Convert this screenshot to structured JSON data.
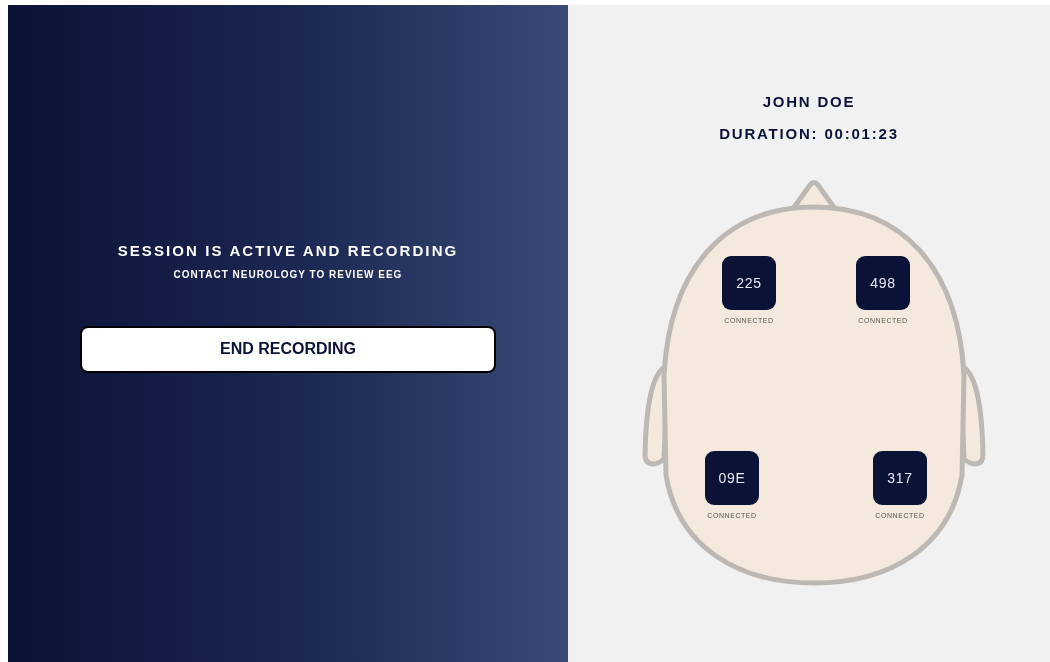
{
  "session": {
    "title": "SESSION IS ACTIVE AND RECORDING",
    "subtitle": "CONTACT NEUROLOGY TO REVIEW EEG",
    "button": "END RECORDING"
  },
  "patient": {
    "name": "JOHN DOE",
    "duration": "DURATION: 00:01:23"
  },
  "sensors": [
    {
      "id": "225",
      "status": "CONNECTED"
    },
    {
      "id": "498",
      "status": "CONNECTED"
    },
    {
      "id": "09E",
      "status": "CONNECTED"
    },
    {
      "id": "317",
      "status": "CONNECTED"
    }
  ]
}
